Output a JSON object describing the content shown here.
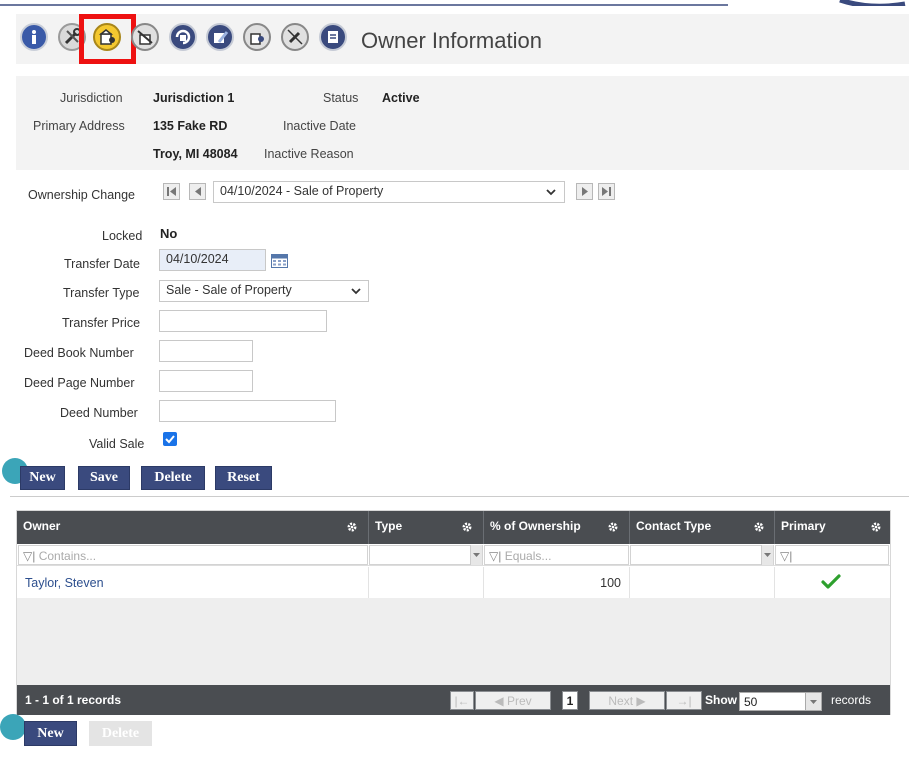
{
  "colors": {
    "accent": "#3a4a7e",
    "grid_header": "#4a4d51",
    "highlight": "#ee1111",
    "teal_dot": "#3ba5b8",
    "check": "#2ea02e"
  },
  "toolbar": {
    "icons": [
      "info-icon",
      "tools-icon",
      "building-owner-icon",
      "tools-building-icon",
      "building-rotate-icon",
      "building-edit-icon",
      "building-person-icon",
      "pencil-off-icon",
      "document-icon"
    ],
    "title": "Owner Information"
  },
  "info": {
    "jurisdiction_label": "Jurisdiction",
    "jurisdiction_value": "Jurisdiction 1",
    "status_label": "Status",
    "status_value": "Active",
    "primary_address_label": "Primary Address",
    "address_line1": "135 Fake RD",
    "address_line2": "Troy, MI 48084",
    "inactive_date_label": "Inactive Date",
    "inactive_reason_label": "Inactive Reason"
  },
  "form": {
    "ownership_change_label": "Ownership Change",
    "ownership_change_value": "04/10/2024 - Sale of Property",
    "locked_label": "Locked",
    "locked_value": "No",
    "transfer_date_label": "Transfer Date",
    "transfer_date_value": "04/10/2024",
    "transfer_type_label": "Transfer Type",
    "transfer_type_value": "Sale - Sale of Property",
    "transfer_price_label": "Transfer Price",
    "deed_book_label": "Deed Book Number",
    "deed_page_label": "Deed Page Number",
    "deed_number_label": "Deed Number",
    "valid_sale_label": "Valid Sale",
    "valid_sale_checked": true
  },
  "buttons": {
    "new": "New",
    "save": "Save",
    "delete": "Delete",
    "reset": "Reset"
  },
  "grid": {
    "columns": [
      "Owner",
      "Type",
      "% of Ownership",
      "Contact Type",
      "Primary"
    ],
    "filters": {
      "owner_placeholder": "Contains...",
      "ownership_placeholder": "Equals..."
    },
    "rows": [
      {
        "owner": "Taylor, Steven",
        "type": "",
        "ownership": "100",
        "contact_type": "",
        "primary": true
      }
    ],
    "footer": {
      "records_text": "1 - 1 of 1 records",
      "prev": "Prev",
      "page": "1",
      "next": "Next",
      "show_label": "Show",
      "page_size": "50",
      "records_label": "records"
    }
  },
  "bottom_buttons": {
    "new": "New",
    "delete": "Delete"
  }
}
